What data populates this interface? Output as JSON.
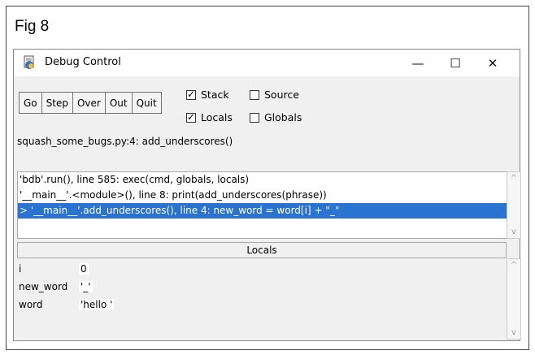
{
  "figure": {
    "label": "Fig 8"
  },
  "window": {
    "title": "Debug Control",
    "controls": {
      "minimize": "—",
      "maximize": "☐",
      "close": "✕"
    }
  },
  "toolbar": {
    "buttons": [
      "Go",
      "Step",
      "Over",
      "Out",
      "Quit"
    ]
  },
  "checkboxes": {
    "stack": {
      "label": "Stack",
      "checked": true
    },
    "source": {
      "label": "Source",
      "checked": false
    },
    "locals": {
      "label": "Locals",
      "checked": true
    },
    "globals": {
      "label": "Globals",
      "checked": false
    }
  },
  "status": "squash_some_bugs.py:4: add_underscores()",
  "stack": [
    "'bdb'.run(), line 585: exec(cmd, globals, locals)",
    "'__main__'.<module>(), line 8: print(add_underscores(phrase))",
    "> '__main__'.add_underscores(), line 4: new_word = word[i] + \"_\""
  ],
  "stack_selected_index": 2,
  "locals": {
    "header": "Locals",
    "rows": [
      {
        "name": "i",
        "value": "0"
      },
      {
        "name": "new_word",
        "value": "'_'"
      },
      {
        "name": "word",
        "value": "'hello '"
      }
    ]
  },
  "colors": {
    "selection": "#2b73d1"
  }
}
